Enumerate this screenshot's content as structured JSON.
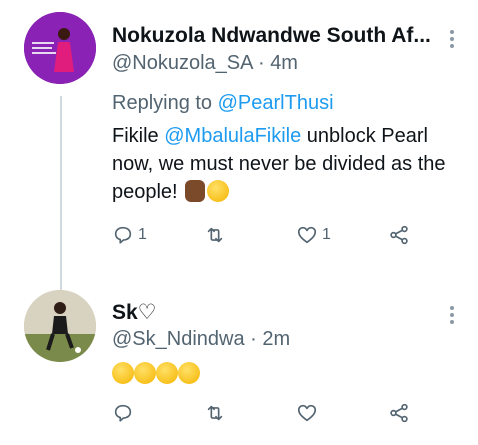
{
  "tweets": [
    {
      "name": "Nokuzola Ndwandwe South Af...",
      "handle": "@Nokuzola_SA",
      "separator": "·",
      "time": "4m",
      "replying_prefix": "Replying to ",
      "replying_to": "@PearlThusi",
      "text_before_mention": "Fikile ",
      "mention": "@MbalulaFikile",
      "text_after_mention": " unblock Pearl now, we must never be divided as the people!",
      "reply_count": "1",
      "retweet_count": "",
      "like_count": "1"
    },
    {
      "name": "Sk♡",
      "handle": "@Sk_Ndindwa",
      "separator": "·",
      "time": "2m",
      "reply_count": "",
      "retweet_count": "",
      "like_count": ""
    }
  ],
  "icons": {
    "reply": "reply-icon",
    "retweet": "retweet-icon",
    "like": "heart-icon",
    "share": "share-icon",
    "more": "more-vertical-icon"
  },
  "colors": {
    "link": "#1d9bf0",
    "secondary_text": "#536471",
    "thread_line": "#cfd9de"
  }
}
